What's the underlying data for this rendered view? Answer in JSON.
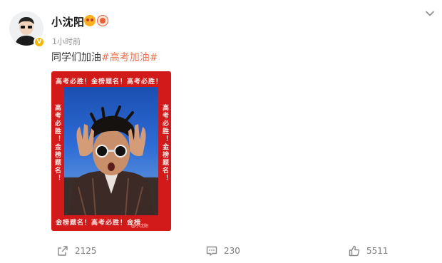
{
  "post": {
    "username": "小沈阳",
    "time": "1小时前",
    "text": "同学们加油",
    "hashtag": "#高考加油#",
    "verified_mark": "V",
    "poster": {
      "top_text": "高考必胜！金榜题名！高考必胜！",
      "bottom_text": "金榜题名！高考必胜！金榜",
      "left_text": "高考必胜！金榜题名！",
      "right_text": "高考必胜！金榜题名！",
      "watermark": "@小沈阳"
    },
    "actions": {
      "repost_count": "2125",
      "comment_count": "230",
      "like_count": "5511"
    }
  },
  "colors": {
    "hashtag": "#eb7350",
    "poster_red": "#d31a1a",
    "verified": "#f7b500"
  },
  "icons": [
    "chevron-down-icon",
    "repost-icon",
    "comment-icon",
    "like-icon",
    "verified-icon"
  ]
}
